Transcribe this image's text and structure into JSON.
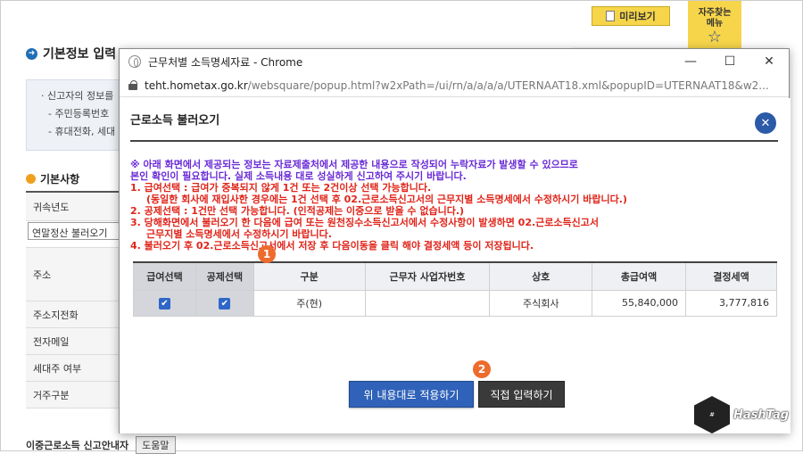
{
  "background": {
    "preview_button": "미리보기",
    "faq": {
      "line1": "자주찾는",
      "line2": "메뉴"
    },
    "section_title": "기본정보 입력",
    "info_lines": [
      "신고자의 정보를",
      "주민등록번호",
      "휴대전화, 세대"
    ],
    "basics_title": "기본사항",
    "row_labels": [
      "귀속년도",
      "주소",
      "주소지전화",
      "전자메일",
      "세대주 여부",
      "거주구분"
    ],
    "select_value": "연말정산 불러오기",
    "bottom_text": "이중근로소득 신고안내자",
    "help_button": "도움말"
  },
  "window": {
    "title": "근무처별 소득명세자료 - Chrome",
    "url_host": "teht.hometax.go.kr",
    "url_path": "/websquare/popup.html?w2xPath=/ui/rn/a/a/a/a/UTERNAAT18.xml&popupID=UTERNAAT18&w2..."
  },
  "popup": {
    "heading": "근로소득 불러오기",
    "notice_purple": [
      "※ 아래 화면에서 제공되는 정보는 자료제출처에서 제공한 내용으로 작성되어 누락자료가 발생할 수 있으므로",
      "본인 확인이 필요합니다. 실제 소득내용 대로 성실하게 신고하여 주시기 바랍니다."
    ],
    "notice_red": [
      "1. 급여선택 : 급여가 중복되지 않게 1건 또는 2건이상 선택 가능합니다.",
      "   (동일한 회사에 재입사한 경우에는 1건 선택 후 02.근로소득신고서의 근무지별 소득명세에서 수정하시기 바랍니다.)",
      "2. 공제선택 : 1건만 선택 가능합니다. (인적공제는 이중으로 받을 수 없습니다.)",
      "3. 당해화면에서 불러오기 한 다음에 급여 또는 원천징수소득신고서에서 수정사항이 발생하면 02.근로소득신고서",
      "   근무지별 소득명세에서 수정하시기 바랍니다.",
      "4. 불러오기 후 02.근로소득신고서에서 저장 후 다음이동을 클릭 해야 결정세액 등이 저장됩니다."
    ],
    "table": {
      "headers": [
        "급여선택",
        "공제선택",
        "구분",
        "근무자 사업자번호",
        "상호",
        "총급여액",
        "결정세액"
      ],
      "row": {
        "category": "주(현)",
        "biz_no": "",
        "company": "주식회사",
        "total_pay": "55,840,000",
        "tax": "3,777,816"
      }
    },
    "apply_button": "위 내용대로 적용하기",
    "manual_button": "직접 입력하기"
  },
  "marks": [
    "1",
    "2"
  ],
  "watermark": "HashTag",
  "colors": {
    "accent": "#2f62b8",
    "red": "#e0251a",
    "purple": "#6a2bd6",
    "mark": "#ee6b2e"
  }
}
